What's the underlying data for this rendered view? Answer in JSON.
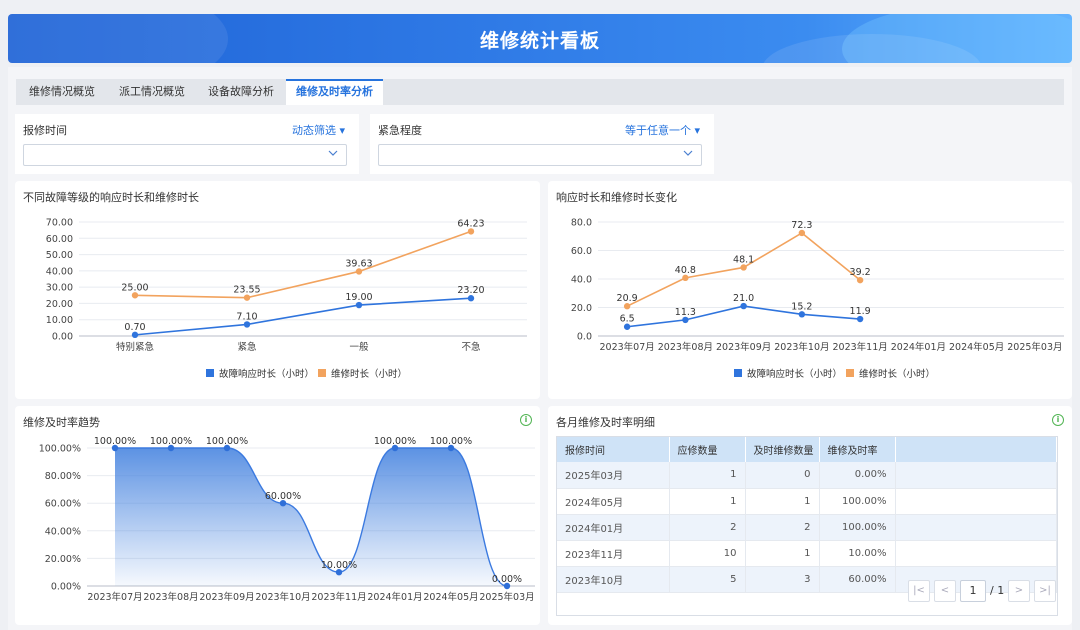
{
  "header": {
    "title": "维修统计看板"
  },
  "tabs": [
    {
      "label": "维修情况概览"
    },
    {
      "label": "派工情况概览"
    },
    {
      "label": "设备故障分析"
    },
    {
      "label": "维修及时率分析",
      "active": true
    }
  ],
  "filters": [
    {
      "label": "报修时间",
      "mode": "动态筛选",
      "value": ""
    },
    {
      "label": "紧急程度",
      "mode": "等于任意一个",
      "value": ""
    }
  ],
  "colors": {
    "primary": "#2673dd",
    "blue_series": "#2f74dd",
    "orange_series": "#f2a35e",
    "header_bg": "#2a6fdd"
  },
  "panels": {
    "level_chart_title": "不同故障等级的响应时长和维修时长",
    "trend_chart_title": "响应时长和维修时长变化",
    "rate_chart_title": "维修及时率趋势",
    "table_title": "各月维修及时率明细"
  },
  "legend": {
    "response": "故障响应时长（小时）",
    "repair": "维修时长（小时）"
  },
  "table": {
    "columns": [
      "报修时间",
      "应修数量",
      "及时维修数量",
      "维修及时率"
    ],
    "rows": [
      [
        "2025年03月",
        "1",
        "0",
        "0.00%"
      ],
      [
        "2024年05月",
        "1",
        "1",
        "100.00%"
      ],
      [
        "2024年01月",
        "2",
        "2",
        "100.00%"
      ],
      [
        "2023年11月",
        "10",
        "1",
        "10.00%"
      ],
      [
        "2023年10月",
        "5",
        "3",
        "60.00%"
      ]
    ]
  },
  "pagination": {
    "current": "1",
    "total": "/ 1"
  },
  "chart_data": [
    {
      "type": "line",
      "title": "不同故障等级的响应时长和维修时长",
      "categories": [
        "特别紧急",
        "紧急",
        "一般",
        "不急"
      ],
      "ylim": [
        0,
        70
      ],
      "yticks": [
        "0.00",
        "10.00",
        "20.00",
        "30.00",
        "40.00",
        "50.00",
        "60.00",
        "70.00"
      ],
      "series": [
        {
          "name": "故障响应时长（小时）",
          "values": [
            0.7,
            7.1,
            19.0,
            23.2
          ],
          "labels": [
            "0.70",
            "7.10",
            "19.00",
            "23.20"
          ]
        },
        {
          "name": "维修时长（小时）",
          "values": [
            25.0,
            23.55,
            39.63,
            64.23
          ],
          "labels": [
            "25.00",
            "23.55",
            "39.63",
            "64.23"
          ]
        }
      ],
      "legend": "bottom-center",
      "grid": true
    },
    {
      "type": "line",
      "title": "响应时长和维修时长变化",
      "categories": [
        "2023年07月",
        "2023年08月",
        "2023年09月",
        "2023年10月",
        "2023年11月",
        "2024年01月",
        "2024年05月",
        "2025年03月"
      ],
      "ylim": [
        0,
        80
      ],
      "yticks": [
        "0.0",
        "20.0",
        "40.0",
        "60.0",
        "80.0"
      ],
      "series": [
        {
          "name": "故障响应时长（小时）",
          "values": [
            6.5,
            11.3,
            21.0,
            15.2,
            11.9
          ],
          "labels": [
            "6.5",
            "11.3",
            "21.0",
            "15.2",
            "11.9"
          ]
        },
        {
          "name": "维修时长（小时）",
          "values": [
            20.9,
            40.8,
            48.1,
            72.3,
            39.2
          ],
          "labels": [
            "20.9",
            "40.8",
            "48.1",
            "72.3",
            "39.2"
          ]
        }
      ],
      "legend": "bottom-center",
      "grid": true
    },
    {
      "type": "area",
      "title": "维修及时率趋势",
      "categories": [
        "2023年07月",
        "2023年08月",
        "2023年09月",
        "2023年10月",
        "2023年11月",
        "2024年01月",
        "2024年05月",
        "2025年03月"
      ],
      "ylim": [
        0,
        100
      ],
      "yticks": [
        "0.00%",
        "20.00%",
        "40.00%",
        "60.00%",
        "80.00%",
        "100.00%"
      ],
      "series": [
        {
          "values": [
            100,
            100,
            100,
            60,
            10,
            100,
            100,
            0
          ],
          "labels": [
            "100.00%",
            "100.00%",
            "100.00%",
            "60.00%",
            "10.00%",
            "100.00%",
            "100.00%",
            "0.00%"
          ]
        }
      ],
      "grid": true
    }
  ]
}
